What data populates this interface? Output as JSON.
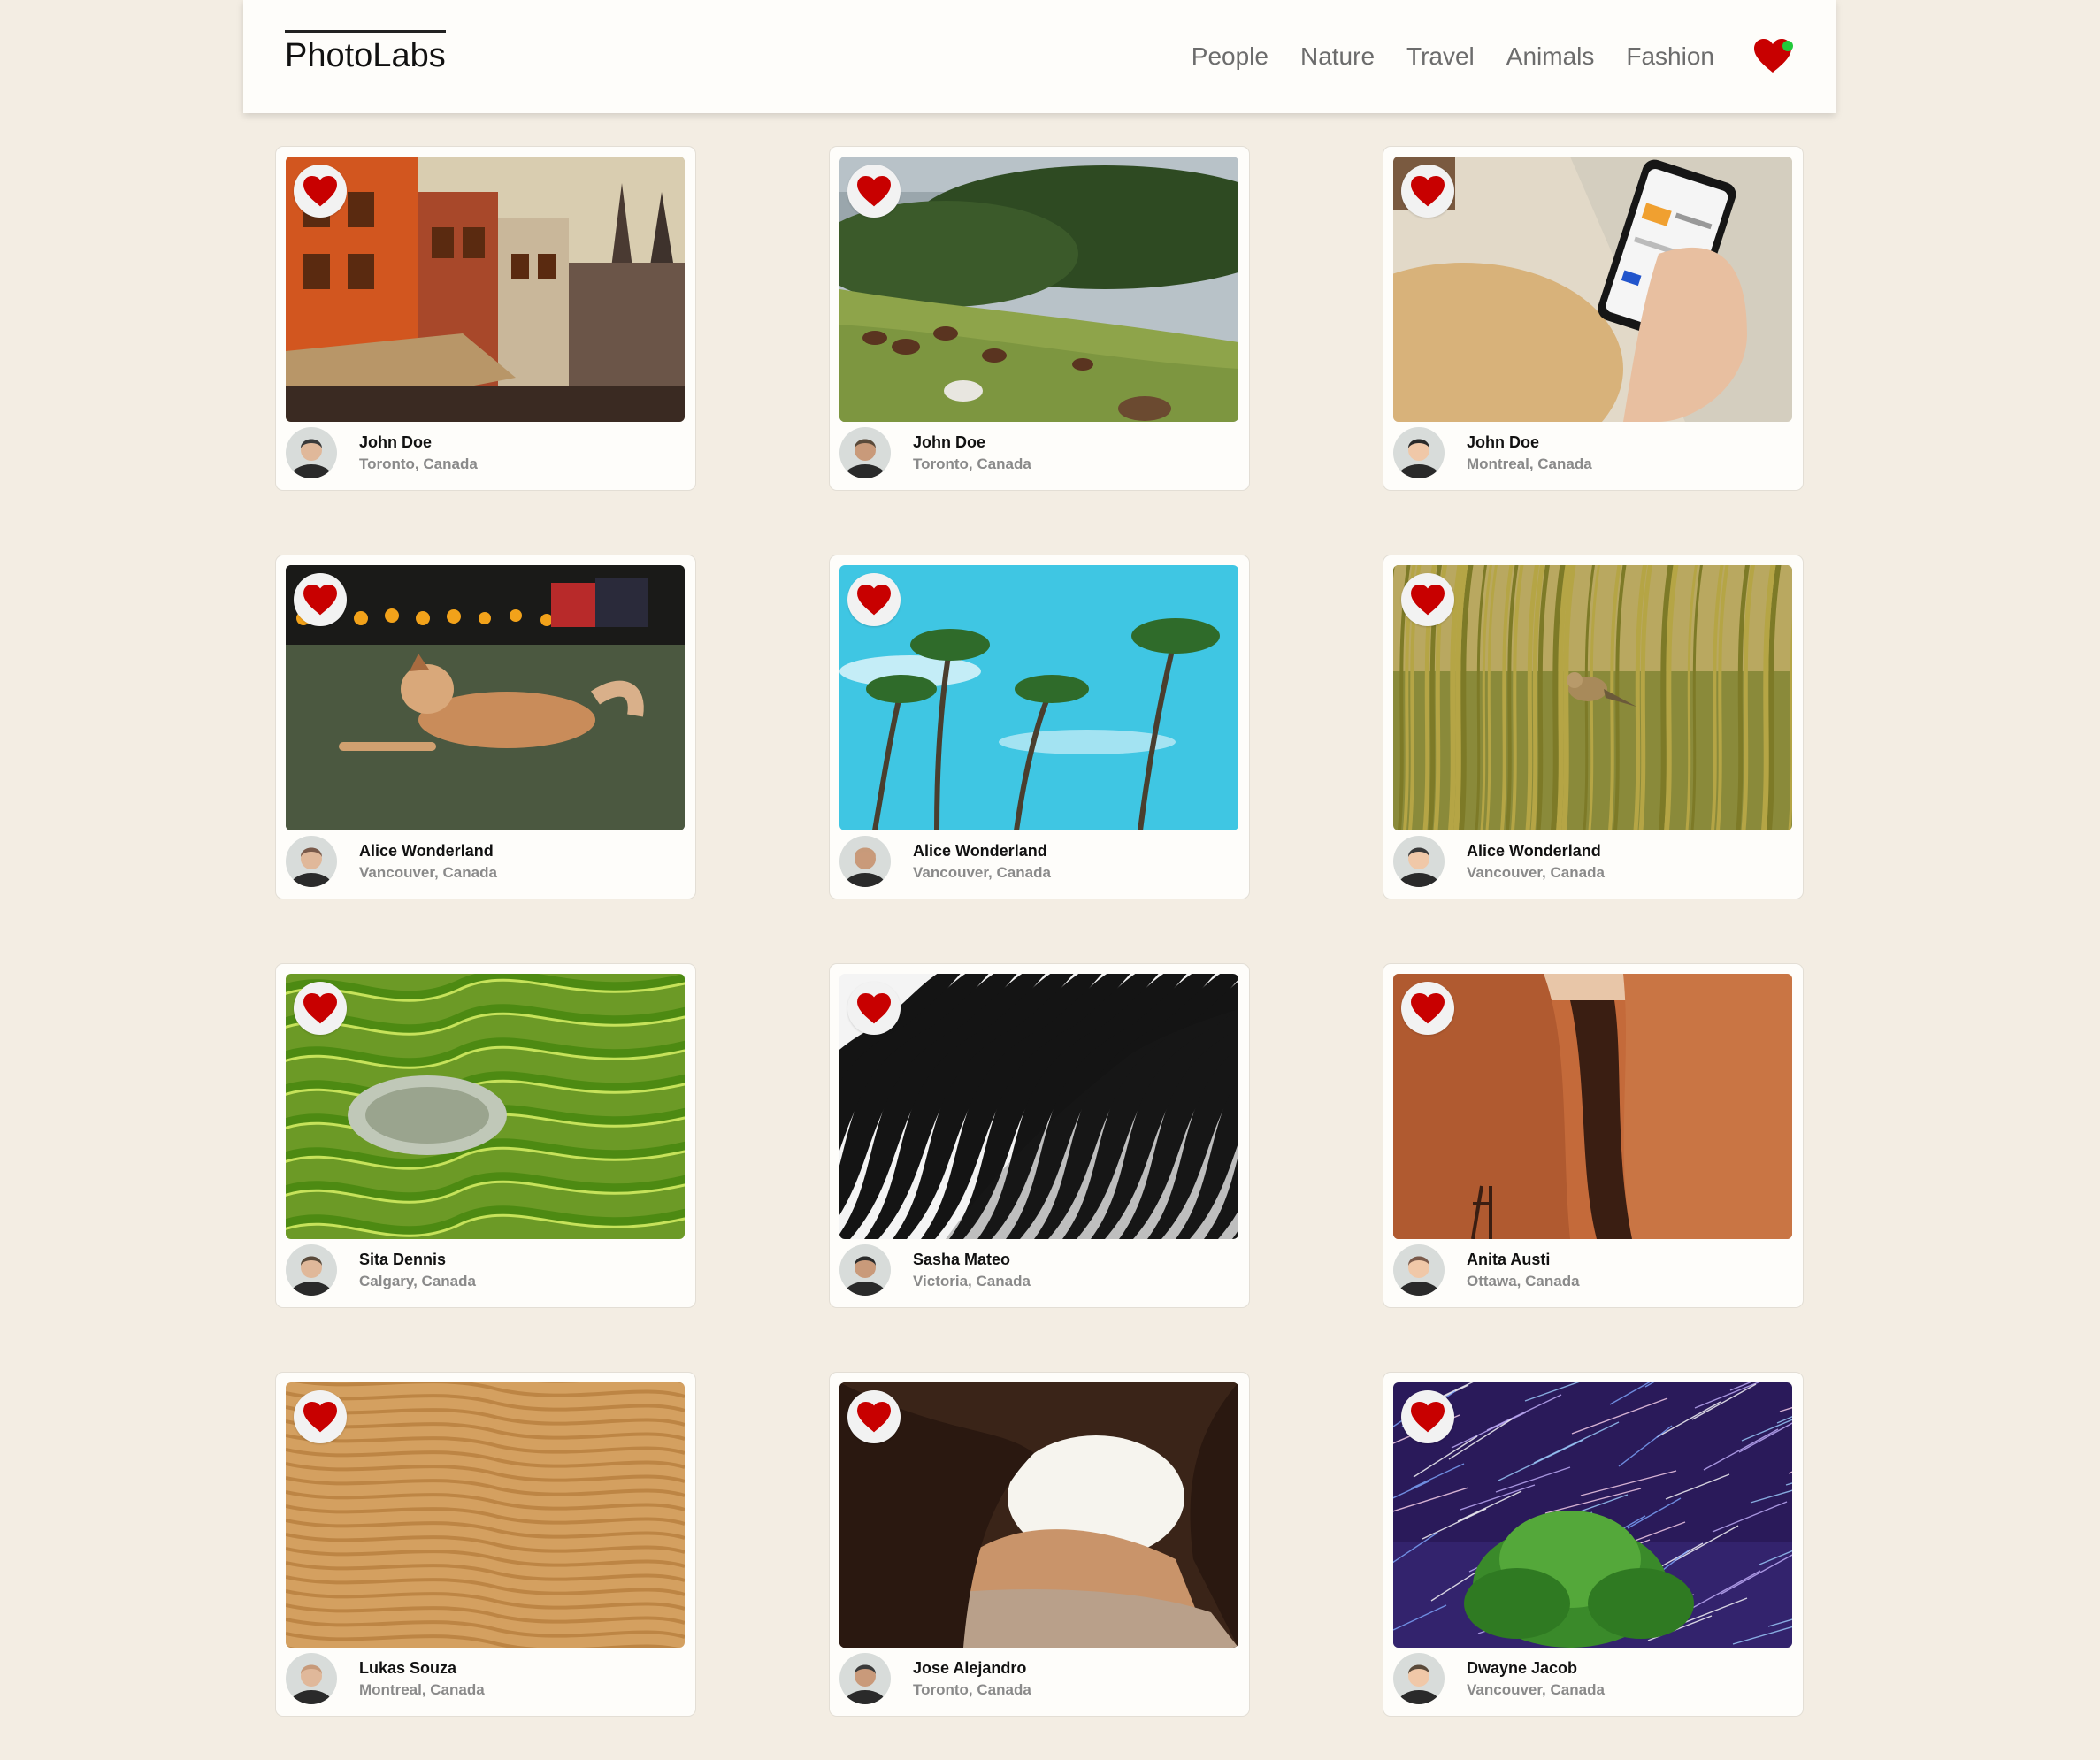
{
  "app": {
    "logo": "PhotoLabs",
    "topics": [
      "People",
      "Nature",
      "Travel",
      "Animals",
      "Fashion"
    ],
    "favorites_has_new": true,
    "colors": {
      "heart": "#c80000",
      "new_dot": "#22c93a",
      "background": "#f3ede3"
    }
  },
  "photos": [
    {
      "name": "John Doe",
      "location": "Toronto, Canada",
      "image": "old-city-buildings",
      "liked": true
    },
    {
      "name": "John Doe",
      "location": "Toronto, Canada",
      "image": "horses-grazing-hillside",
      "liked": true
    },
    {
      "name": "John Doe",
      "location": "Montreal, Canada",
      "image": "hand-holding-phone",
      "liked": true
    },
    {
      "name": "Alice Wonderland",
      "location": "Vancouver, Canada",
      "image": "dog-lying-on-grass",
      "liked": true
    },
    {
      "name": "Alice Wonderland",
      "location": "Vancouver, Canada",
      "image": "palm-trees-blue-sky",
      "liked": true
    },
    {
      "name": "Alice Wonderland",
      "location": "Vancouver, Canada",
      "image": "bird-in-reeds",
      "liked": true
    },
    {
      "name": "Sita Dennis",
      "location": "Calgary, Canada",
      "image": "rice-terraces",
      "liked": true
    },
    {
      "name": "Sasha Mateo",
      "location": "Victoria, Canada",
      "image": "zebra-stripes",
      "liked": true
    },
    {
      "name": "Anita Austi",
      "location": "Ottawa, Canada",
      "image": "red-rock-canyon",
      "liked": true
    },
    {
      "name": "Lukas Souza",
      "location": "Montreal, Canada",
      "image": "sand-dunes",
      "liked": true
    },
    {
      "name": "Jose Alejandro",
      "location": "Toronto, Canada",
      "image": "cave-opening",
      "liked": true
    },
    {
      "name": "Dwayne Jacob",
      "location": "Vancouver, Canada",
      "image": "star-trails-tree",
      "liked": true
    }
  ]
}
